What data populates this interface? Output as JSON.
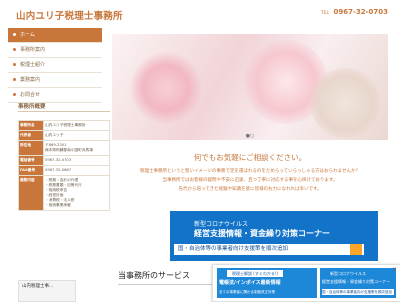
{
  "header": {
    "site_title": "山内ユリ子税理士事務所",
    "tel_label": "TEL",
    "tel_number": "0967-32-0703"
  },
  "nav": {
    "items": [
      {
        "label": "ホーム"
      },
      {
        "label": "事務所案内"
      },
      {
        "label": "税理士紹介"
      },
      {
        "label": "業務案内"
      },
      {
        "label": "お問合せ"
      }
    ]
  },
  "sidebar": {
    "summary_title": "事務所概要",
    "info": [
      {
        "k": "事務所名",
        "v": "山内ユリ子税理士事務所"
      },
      {
        "k": "代表者",
        "v": "山内ユリ子"
      },
      {
        "k": "所在地",
        "v": "〒869-2301\n熊本県阿蘇郡南小国町赤馬場"
      },
      {
        "k": "電話番号",
        "v": "0967-32-0703"
      },
      {
        "k": "FAX番号",
        "v": "0967-32-0867"
      },
      {
        "k": "業務内容",
        "v": "・税務・会計の代理\n・税務書類・記帳代行\n・相続税申告\n・経営計画\n・消費税・法人税\n・相続事業承継"
      }
    ],
    "box_title": "山内税理士事..."
  },
  "intro": {
    "headline": "何でもお気軽にご相談ください。",
    "lines": [
      "税理士事務所というと堅いイメージの事務で足を運ばれるのをためらっていらっしゃる方はおられませんか？",
      "当事務所ではお客様の疑問や不安に迅速、且つ丁寧に対応する事を心掛けております。",
      "先代から培ってきた経験や知識を基に皆様のお力になれれば幸いです。"
    ]
  },
  "banner": {
    "sub": "新型コロナウイルス",
    "main": "経営支援情報・資金繰り対策コーナー",
    "cta": "国・自治体等の事業者向け支援策を順次追加"
  },
  "services": {
    "title": "当事務所のサービス"
  },
  "popup": {
    "badge": "税理士解説 (すぐわかる!)",
    "left_main": "電帳法/インボイス最新情報",
    "left_sub": "全ての事業者に関わる制度改正対策",
    "right_sub": "新型コロナウイルス",
    "right_main": "経営支援情報・資金繰り対策コーナー",
    "right_cta": "国・自治体等の事業者向け支援策を順次追加",
    "close": "×"
  },
  "carousel": {
    "dots": "●○"
  },
  "colors": {
    "accent": "#c8763a",
    "blue": "#1273c9",
    "cta_orange": "#ffa62a"
  }
}
